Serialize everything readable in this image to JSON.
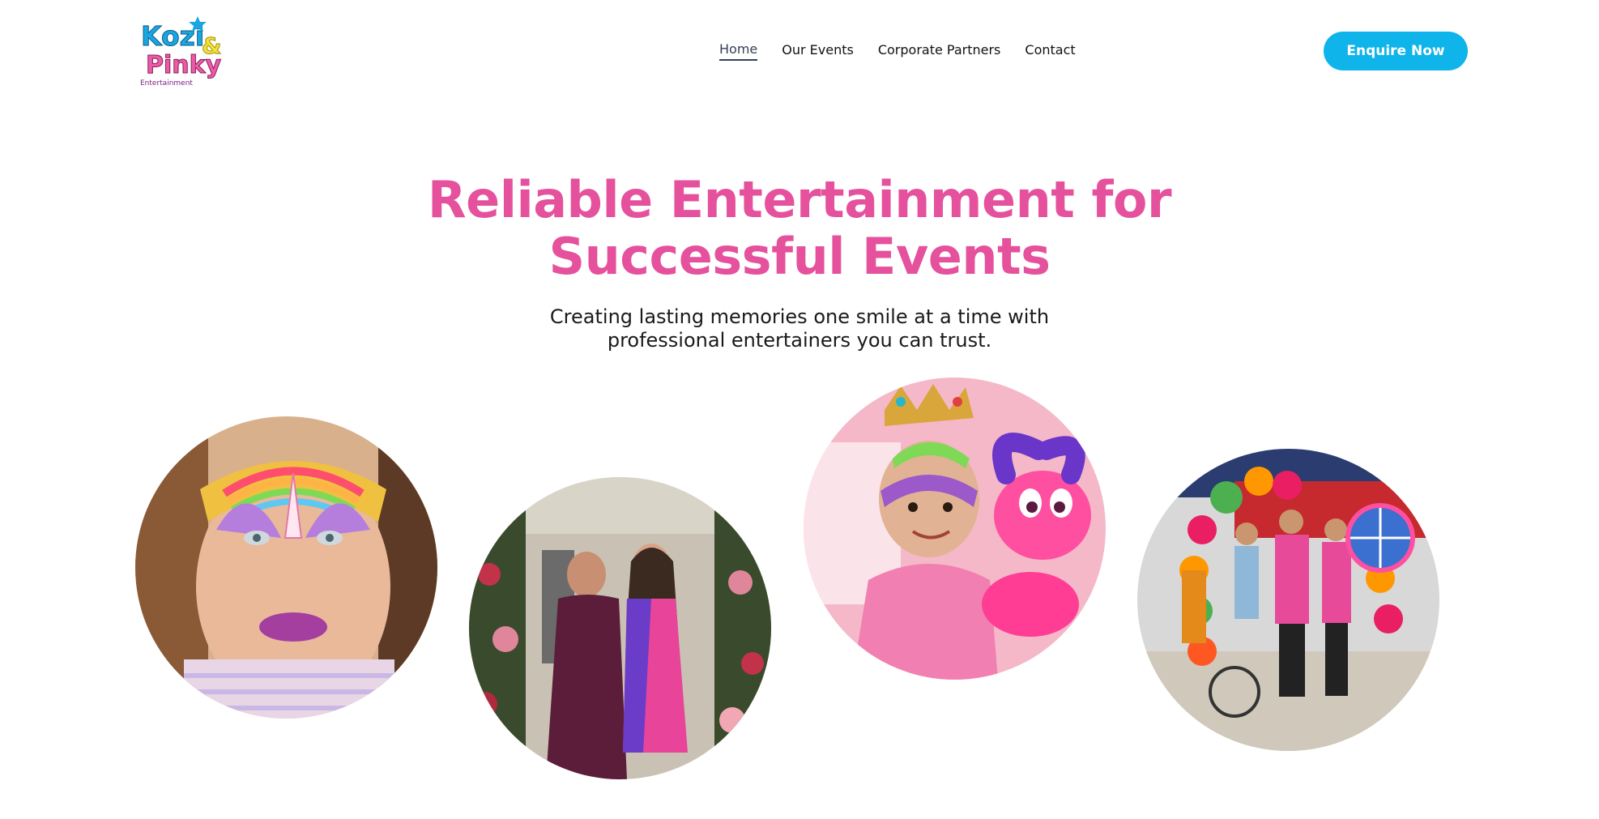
{
  "brand": {
    "logo_line1": "Kozi",
    "logo_amp": "&",
    "logo_line2": "Pinky",
    "logo_sub": "Entertainment",
    "colors": {
      "pink": "#e5519c",
      "blue": "#0eb4ea",
      "yellow": "#f4e23a"
    }
  },
  "nav": {
    "items": [
      {
        "label": "Home",
        "active": true
      },
      {
        "label": "Our Events",
        "active": false
      },
      {
        "label": "Corporate Partners",
        "active": false
      },
      {
        "label": "Contact",
        "active": false
      }
    ]
  },
  "cta": {
    "label": "Enquire Now"
  },
  "hero": {
    "title_line1": "Reliable Entertainment for",
    "title_line2": "Successful Events",
    "subtitle_line1": "Creating lasting memories one smile at a time with",
    "subtitle_line2": "professional entertainers you can trust."
  },
  "gallery": {
    "photos": [
      {
        "subject": "face-painted-child-photo"
      },
      {
        "subject": "two-women-event-photo"
      },
      {
        "subject": "child-balloon-animal-photo"
      },
      {
        "subject": "entertainers-balloon-arch-photo"
      }
    ]
  }
}
